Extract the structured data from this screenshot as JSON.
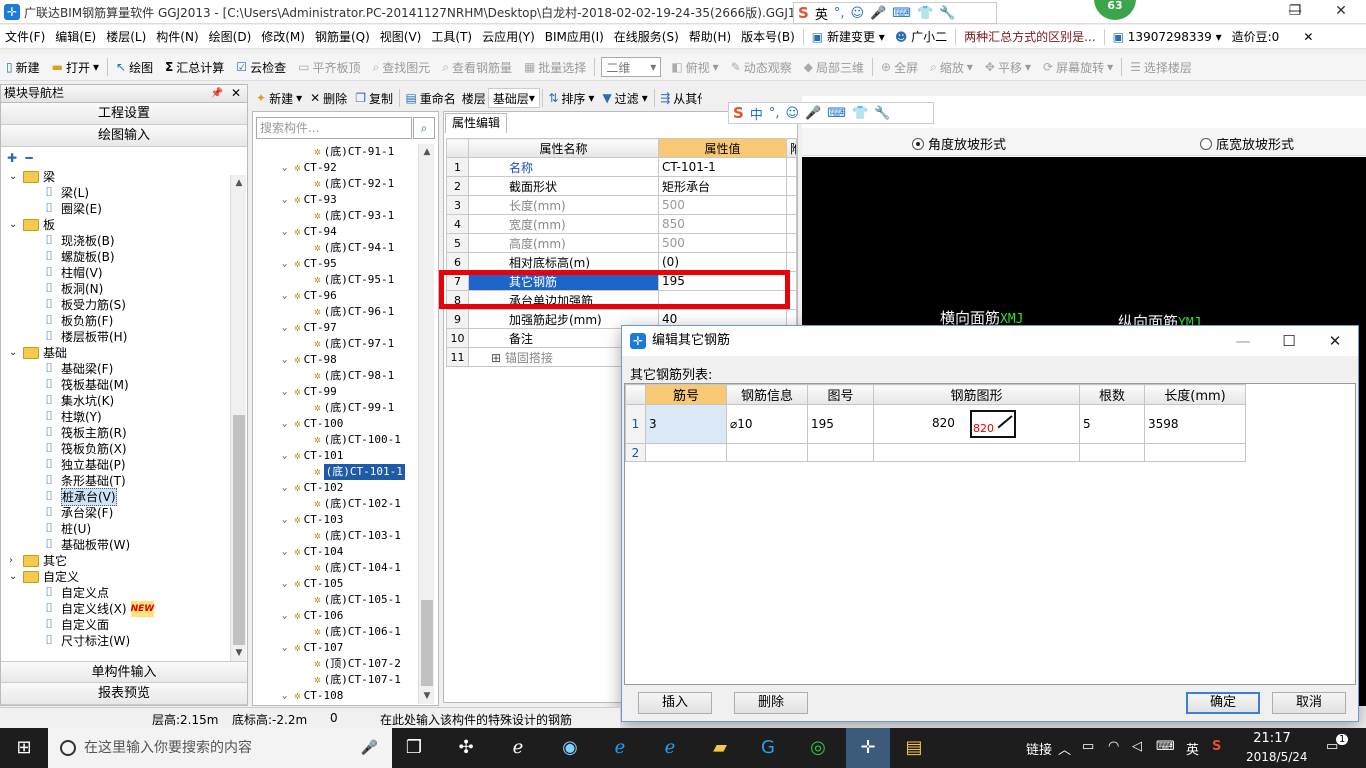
{
  "window": {
    "title": "广联达BIM钢筋算量软件 GGJ2013 - [C:\\Users\\Administrator.PC-20141127NRHM\\Desktop\\白龙村-2018-02-02-19-24-35(2666版).GGJ12]",
    "badge": "63",
    "min": "—",
    "max": "❐",
    "close": "✕"
  },
  "ime_bar": {
    "s": "S",
    "lang": "英",
    "p": "°,",
    "emoji": "☺",
    "mic": "🎤",
    "kb": "⌨",
    "shirt": "👕",
    "tool": "🔧"
  },
  "menu": {
    "items": [
      "文件(F)",
      "编辑(E)",
      "楼层(L)",
      "构件(N)",
      "绘图(D)",
      "修改(M)",
      "钢筋量(Q)",
      "视图(V)",
      "工具(T)",
      "云应用(Y)",
      "BIM应用(I)",
      "在线服务(S)",
      "帮助(H)",
      "版本号(B)"
    ],
    "new_change": "新建变更",
    "assistant": "广小二",
    "ad": "两种汇总方式的区别是...",
    "phone": "13907298339",
    "bean": "造价豆:0"
  },
  "toolbar1": {
    "new": "新建",
    "open": "打开",
    "draw": "绘图",
    "sum": "汇总计算",
    "cloud": "云检查",
    "flat": "平齐板顶",
    "find": "查找图元",
    "view_rebar": "查看钢筋量",
    "batch": "批量选择",
    "view_mode": "二维",
    "top": "俯视",
    "dynamic": "动态观察",
    "local3d": "局部三维",
    "full": "全屏",
    "zoom": "缩放",
    "pan": "平移",
    "rotate": "屏幕旋转",
    "sel_floor": "选择楼层"
  },
  "nav": {
    "header": "模块导航栏",
    "pin": "中",
    "close": "✕",
    "project_settings": "工程设置",
    "draw_input": "绘图输入",
    "single_input": "单构件输入",
    "report": "报表预览",
    "tree": [
      {
        "label": "梁",
        "type": "folder"
      },
      {
        "label": "梁(L)",
        "type": "item"
      },
      {
        "label": "圈梁(E)",
        "type": "item"
      },
      {
        "label": "板",
        "type": "folder"
      },
      {
        "label": "现浇板(B)",
        "type": "item"
      },
      {
        "label": "螺旋板(B)",
        "type": "item"
      },
      {
        "label": "柱帽(V)",
        "type": "item"
      },
      {
        "label": "板洞(N)",
        "type": "item"
      },
      {
        "label": "板受力筋(S)",
        "type": "item"
      },
      {
        "label": "板负筋(F)",
        "type": "item"
      },
      {
        "label": "楼层板带(H)",
        "type": "item"
      },
      {
        "label": "基础",
        "type": "folder"
      },
      {
        "label": "基础梁(F)",
        "type": "item"
      },
      {
        "label": "筏板基础(M)",
        "type": "item"
      },
      {
        "label": "集水坑(K)",
        "type": "item"
      },
      {
        "label": "柱墩(Y)",
        "type": "item"
      },
      {
        "label": "筏板主筋(R)",
        "type": "item"
      },
      {
        "label": "筏板负筋(X)",
        "type": "item"
      },
      {
        "label": "独立基础(P)",
        "type": "item"
      },
      {
        "label": "条形基础(T)",
        "type": "item"
      },
      {
        "label": "桩承台(V)",
        "type": "item",
        "selected": true
      },
      {
        "label": "承台梁(F)",
        "type": "item"
      },
      {
        "label": "桩(U)",
        "type": "item"
      },
      {
        "label": "基础板带(W)",
        "type": "item"
      },
      {
        "label": "其它",
        "type": "folder-c"
      },
      {
        "label": "自定义",
        "type": "folder"
      },
      {
        "label": "自定义点",
        "type": "item"
      },
      {
        "label": "自定义线(X)",
        "type": "item",
        "new": "NEW"
      },
      {
        "label": "自定义面",
        "type": "item"
      },
      {
        "label": "尺寸标注(W)",
        "type": "item"
      }
    ]
  },
  "comp_toolbar": {
    "new": "新建",
    "delete": "删除",
    "copy": "复制",
    "rename": "重命名",
    "floor": "楼层",
    "floor_val": "基础层",
    "sort": "排序",
    "filter": "过滤",
    "from_other": "从其他楼层复"
  },
  "comp": {
    "search_placeholder": "搜索构件...",
    "rows": [
      {
        "t": "(底)CT-91-1",
        "lv": 2
      },
      {
        "t": "CT-92",
        "lv": 1
      },
      {
        "t": "(底)CT-92-1",
        "lv": 2
      },
      {
        "t": "CT-93",
        "lv": 1
      },
      {
        "t": "(底)CT-93-1",
        "lv": 2
      },
      {
        "t": "CT-94",
        "lv": 1
      },
      {
        "t": "(底)CT-94-1",
        "lv": 2
      },
      {
        "t": "CT-95",
        "lv": 1
      },
      {
        "t": "(底)CT-95-1",
        "lv": 2
      },
      {
        "t": "CT-96",
        "lv": 1
      },
      {
        "t": "(底)CT-96-1",
        "lv": 2
      },
      {
        "t": "CT-97",
        "lv": 1
      },
      {
        "t": "(底)CT-97-1",
        "lv": 2
      },
      {
        "t": "CT-98",
        "lv": 1
      },
      {
        "t": "(底)CT-98-1",
        "lv": 2
      },
      {
        "t": "CT-99",
        "lv": 1
      },
      {
        "t": "(底)CT-99-1",
        "lv": 2
      },
      {
        "t": "CT-100",
        "lv": 1
      },
      {
        "t": "(底)CT-100-1",
        "lv": 2
      },
      {
        "t": "CT-101",
        "lv": 1
      },
      {
        "t": "(底)CT-101-1",
        "lv": 2,
        "selected": true
      },
      {
        "t": "CT-102",
        "lv": 1
      },
      {
        "t": "(底)CT-102-1",
        "lv": 2
      },
      {
        "t": "CT-103",
        "lv": 1
      },
      {
        "t": "(底)CT-103-1",
        "lv": 2
      },
      {
        "t": "CT-104",
        "lv": 1
      },
      {
        "t": "(底)CT-104-1",
        "lv": 2
      },
      {
        "t": "CT-105",
        "lv": 1
      },
      {
        "t": "(底)CT-105-1",
        "lv": 2
      },
      {
        "t": "CT-106",
        "lv": 1
      },
      {
        "t": "(底)CT-106-1",
        "lv": 2
      },
      {
        "t": "CT-107",
        "lv": 1
      },
      {
        "t": "(顶)CT-107-2",
        "lv": 2
      },
      {
        "t": "(底)CT-107-1",
        "lv": 2
      },
      {
        "t": "CT-108",
        "lv": 1
      }
    ]
  },
  "props": {
    "tab": "属性编辑",
    "col_name": "属性名称",
    "col_value": "属性值",
    "col_extra": "附",
    "rows": [
      {
        "n": "1",
        "name": "名称",
        "value": "CT-101-1",
        "style": "blue"
      },
      {
        "n": "2",
        "name": "截面形状",
        "value": "矩形承台",
        "style": ""
      },
      {
        "n": "3",
        "name": "长度(mm)",
        "value": "500",
        "style": "gray"
      },
      {
        "n": "4",
        "name": "宽度(mm)",
        "value": "850",
        "style": "gray"
      },
      {
        "n": "5",
        "name": "高度(mm)",
        "value": "500",
        "style": "gray"
      },
      {
        "n": "6",
        "name": "相对底标高(m)",
        "value": "(0)",
        "style": ""
      },
      {
        "n": "7",
        "name": "其它钢筋",
        "value": "195",
        "style": "sel"
      },
      {
        "n": "8",
        "name": "承台单边加强筋",
        "value": "",
        "style": ""
      },
      {
        "n": "9",
        "name": "加强筋起步(mm)",
        "value": "40",
        "style": ""
      },
      {
        "n": "10",
        "name": "备注",
        "value": "",
        "style": ""
      },
      {
        "n": "11",
        "name": "锚固搭接",
        "value": "",
        "style": "expand"
      }
    ]
  },
  "drawing": {
    "opt1": "角度放坡形式",
    "opt2": "底宽放坡形式",
    "label1": "横向面筋",
    "code1": "XMJ",
    "label2": "纵向面筋",
    "code2": "YMJ"
  },
  "dialog": {
    "title": "编辑其它钢筋",
    "list_label": "其它钢筋列表:",
    "columns": [
      "筋号",
      "钢筋信息",
      "图号",
      "钢筋图形",
      "根数",
      "长度(mm)"
    ],
    "rows": [
      {
        "n": "1",
        "bar_no": "3",
        "info": "⌀10",
        "fig_no": "195",
        "shape_val": "820",
        "shape_inner": "820",
        "count": "5",
        "length": "3598"
      },
      {
        "n": "2",
        "bar_no": "",
        "info": "",
        "fig_no": "",
        "shape_val": "",
        "shape_inner": "",
        "count": "",
        "length": ""
      }
    ],
    "insert": "插入",
    "delete": "删除",
    "ok": "确定",
    "cancel": "取消",
    "min": "—",
    "max": "☐",
    "close": "✕"
  },
  "status": {
    "floor_h": "层高:2.15m",
    "base_h": "底标高:-2.2m",
    "zero": "0",
    "hint": "在此处输入该构件的特殊设计的钢筋"
  },
  "taskbar": {
    "search": "在这里输入你要搜索的内容",
    "link": "链接",
    "lang": "英",
    "time": "21:17",
    "date": "2018/5/24",
    "notif": "1"
  }
}
